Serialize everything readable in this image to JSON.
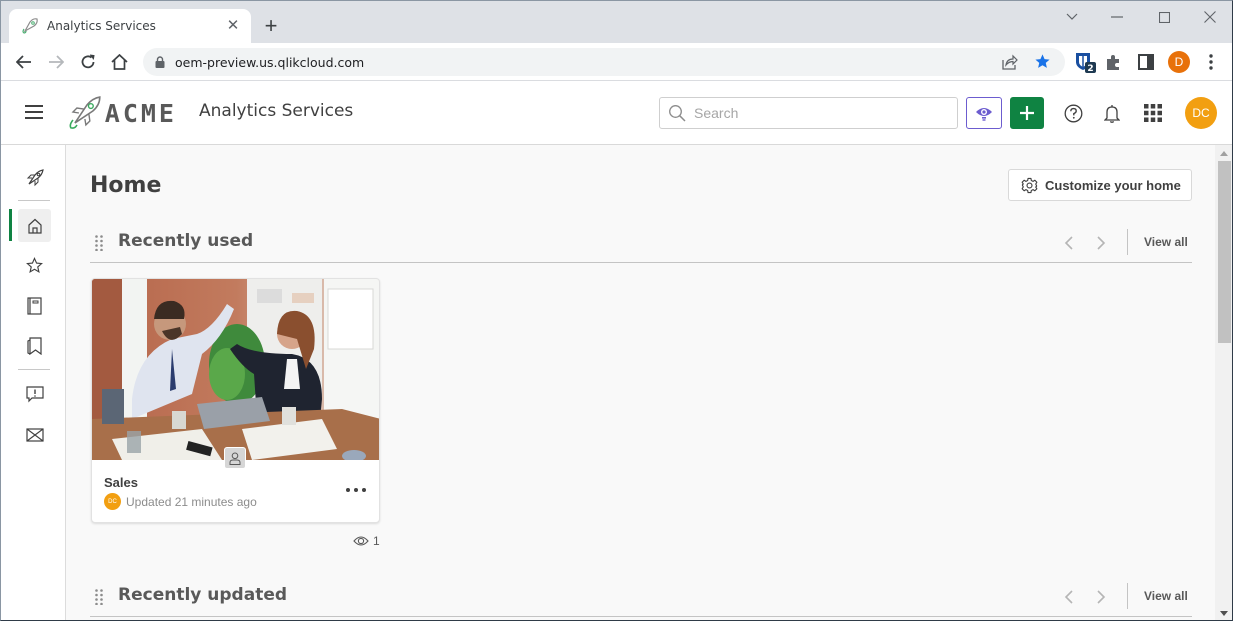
{
  "browser": {
    "tab_title": "Analytics Services",
    "url": "oem-preview.us.qlikcloud.com",
    "extension_badge": "2",
    "profile_initial": "D"
  },
  "header": {
    "logo_text": "ACME",
    "app_title": "Analytics Services",
    "search_placeholder": "Search",
    "search_value": "",
    "user_initials": "DC"
  },
  "sidebar": {
    "items": [
      {
        "name": "catalog",
        "icon": "rocket-icon",
        "active": false
      },
      {
        "name": "home",
        "icon": "home-icon",
        "active": true
      },
      {
        "name": "favorites",
        "icon": "star-icon",
        "active": false
      },
      {
        "name": "collections",
        "icon": "book-icon",
        "active": false
      },
      {
        "name": "bookmarks",
        "icon": "bookmark-icon",
        "active": false
      },
      {
        "name": "feedback",
        "icon": "feedback-icon",
        "active": false
      },
      {
        "name": "messages",
        "icon": "mail-icon",
        "active": false
      }
    ]
  },
  "main": {
    "page_title": "Home",
    "customize_label": "Customize your home",
    "sections": [
      {
        "title": "Recently used",
        "view_all": "View all",
        "items": [
          {
            "title": "Sales",
            "owner_initials": "DC",
            "updated": "Updated 21 minutes ago",
            "views": "1"
          }
        ]
      },
      {
        "title": "Recently updated",
        "view_all": "View all",
        "items": []
      }
    ]
  },
  "colors": {
    "brand_green": "#0f8342",
    "avatar_orange": "#f29f11",
    "insight_purple": "#6c5ccf",
    "chrome_blue": "#1a73e8",
    "profile_orange": "#e8710a"
  }
}
